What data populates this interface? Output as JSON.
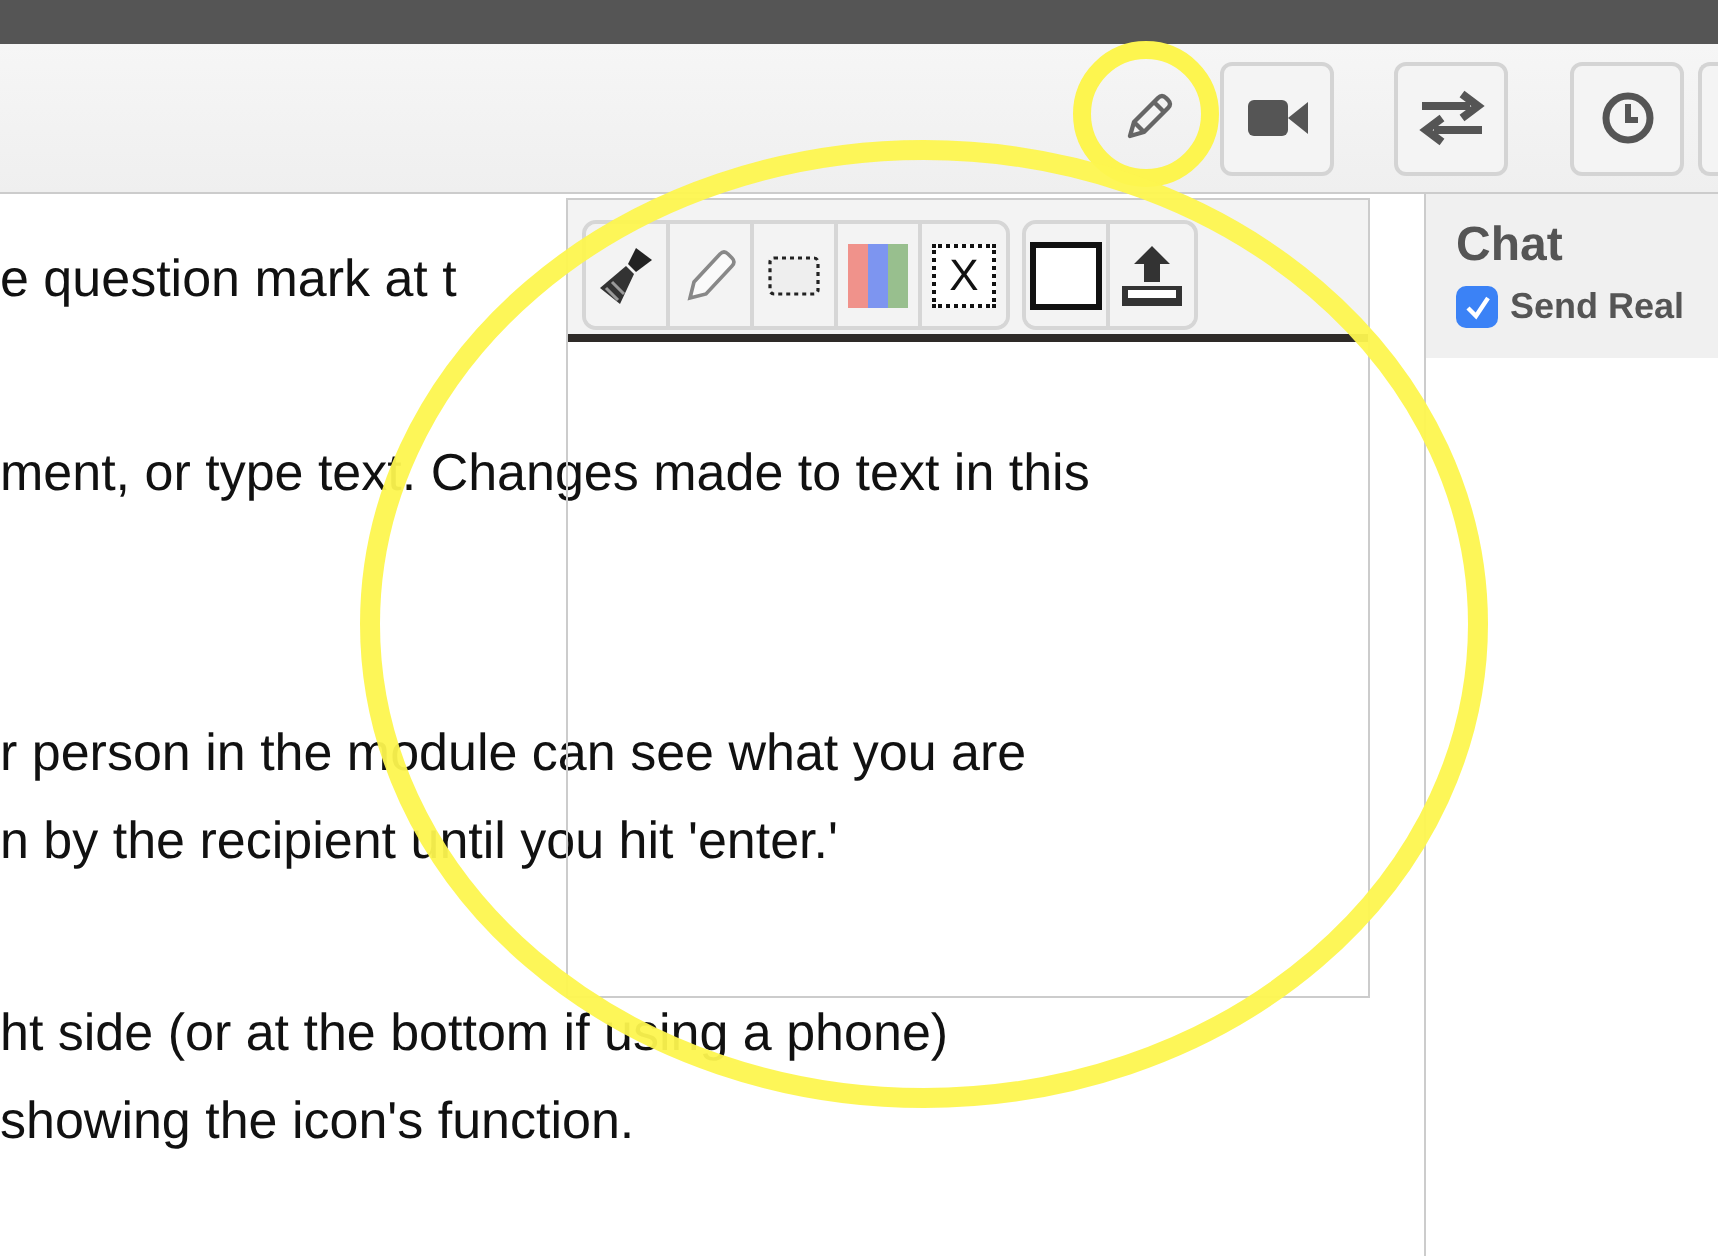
{
  "toolbar": {
    "buttons": [
      {
        "kind": "pencil"
      },
      {
        "kind": "video"
      },
      {
        "kind": "swap"
      },
      {
        "kind": "clock"
      },
      {
        "kind": "partial"
      }
    ]
  },
  "document": {
    "paragraphs": [
      {
        "lines": [
          "e question mark at t"
        ]
      },
      {
        "lines": [
          "ment, or type text. Changes made to text in this"
        ]
      },
      {
        "lines": [
          "r person in the module can see what you are",
          "n by the recipient until you hit 'enter.'"
        ]
      },
      {
        "lines": [
          "ht side (or at the bottom if using a phone)",
          "showing the icon's function."
        ]
      }
    ]
  },
  "whiteboard": {
    "tool_groups": [
      [
        {
          "kind": "brush"
        },
        {
          "kind": "pencil"
        },
        {
          "kind": "select"
        },
        {
          "kind": "colors"
        },
        {
          "kind": "clear",
          "label": "X"
        }
      ],
      [
        {
          "kind": "fill"
        },
        {
          "kind": "upload"
        }
      ]
    ]
  },
  "chat": {
    "title": "Chat",
    "send_realtime": {
      "label": "Send Real",
      "checked": true
    }
  }
}
